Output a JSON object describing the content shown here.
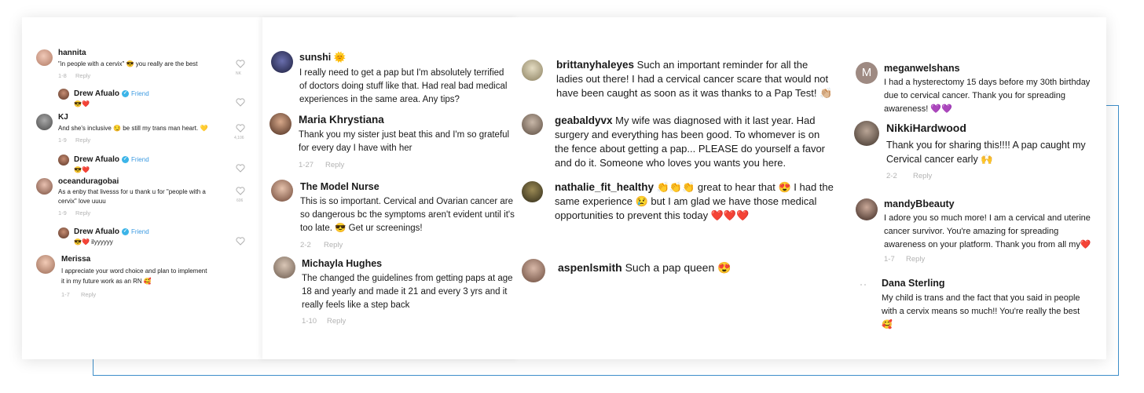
{
  "col1": {
    "comments": [
      {
        "name": "hannita",
        "text": "\"in people with a cervix\" 😎  you really are the best",
        "meta": "1-8",
        "reply": "Reply",
        "likes": "NK"
      },
      {
        "name": "Drew Afualo",
        "badge": "Friend",
        "text": "😎❤️"
      },
      {
        "name": "KJ",
        "text": "And she's inclusive 😏  be still my trans man heart. 💛",
        "meta": "1-9",
        "reply": "Reply",
        "likes": "4,106"
      },
      {
        "name": "Drew Afualo",
        "badge": "Friend",
        "text": "😎❤️"
      },
      {
        "name": "oceanduragobai",
        "text_lines": [
          "As a enby that livesss for u thank u for \"people with a",
          "cervix\" love uuuu"
        ],
        "meta": "1-9",
        "reply": "Reply",
        "likes": "606"
      },
      {
        "name": "Drew Afualo",
        "badge": "Friend",
        "text": "😎❤️ ilyyyyyy"
      },
      {
        "name": "Merissa",
        "text_lines": [
          "I appreciate your word choice and plan to implement",
          "it in my future work as an RN 🥰"
        ],
        "meta": "1-7",
        "reply": "Reply"
      }
    ]
  },
  "col2": {
    "comments": [
      {
        "name": "sunshi 🌞",
        "text_lines": [
          "I really need to get a pap but I'm absolutely terrified",
          "of doctors doing stuff like that. Had real bad medical",
          "experiences in the same area. Any tips?"
        ]
      },
      {
        "name": "Maria Khrystiana",
        "text_lines": [
          "Thank you my sister just beat this and I'm so grateful",
          "for every day I have with her"
        ],
        "meta": "1-27",
        "reply": "Reply"
      },
      {
        "name": "The Model Nurse",
        "text_lines": [
          "This is so important. Cervical and Ovarian cancer are",
          "so dangerous bc the symptoms aren't evident until it's",
          "too late. 😎 Get ur screenings!"
        ],
        "meta": "2-2",
        "reply": "Reply"
      },
      {
        "name": "Michayla Hughes",
        "text_lines": [
          "The changed the guidelines from getting paps at age",
          "18 and yearly and made it 21 and every 3 yrs and it",
          "really feels like a step back"
        ],
        "meta": "1-10",
        "reply": "Reply"
      }
    ]
  },
  "col3": {
    "comments": [
      {
        "name": "brittanyhaleyes",
        "lines": [
          "Such an important reminder for all the",
          "ladies out there! I had a cervical cancer scare that would not",
          "have been caught as soon as it was thanks to a Pap Test! 👏🏼"
        ]
      },
      {
        "name": "geabaldyvx",
        "lines": [
          "My wife was diagnosed with it last year. Had",
          "surgery and everything has been good. To whomever is on",
          "the fence about getting a pap... PLEASE do yourself a favor",
          "and do it. Someone who loves you wants you here."
        ]
      },
      {
        "name": "nathalie_fit_healthy",
        "lines": [
          "👏👏👏 great to hear that 😍 I had the",
          "same experience 😢 but I am glad we have those medical",
          "opportunities to prevent this today ❤️❤️❤️"
        ]
      },
      {
        "name": "aspenlsmith",
        "lines": [
          "Such a pap queen 😍"
        ]
      }
    ]
  },
  "col4": {
    "comments": [
      {
        "name": "meganwelshans",
        "avatar_letter": "M",
        "text_lines": [
          "I had a hysterectomy 15 days before my 30th birthday",
          "due to cervical cancer. Thank you for spreading",
          "awareness! 💜💜"
        ]
      },
      {
        "name": "NikkiHardwood",
        "text_lines": [
          "Thank you for sharing this!!!! A pap caught my",
          "Cervical cancer early 🙌"
        ],
        "meta": "2-2",
        "reply": "Reply"
      },
      {
        "name": "mandyBbeauty",
        "text_lines": [
          "I adore you so much more! I am a cervical and uterine",
          "cancer survivor. You're amazing for spreading",
          "awareness on your platform. Thank you from all my❤️"
        ],
        "meta": "1-7",
        "reply": "Reply"
      },
      {
        "name": "Dana Sterling",
        "text_lines": [
          "My child is trans and the fact that you said in people",
          "with a cervix means so much!! You're really the best",
          "🥰"
        ]
      }
    ]
  }
}
